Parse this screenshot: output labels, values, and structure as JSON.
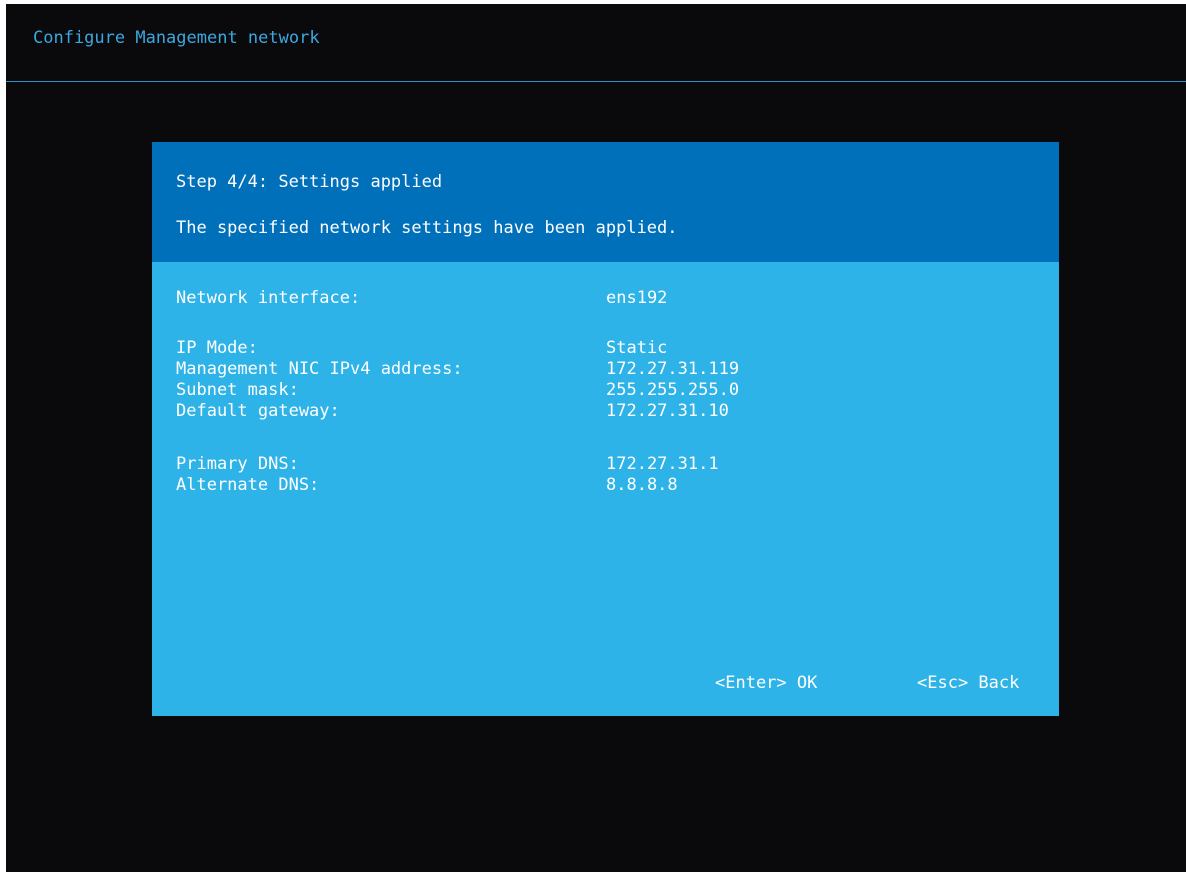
{
  "header": {
    "title": "Configure Management network"
  },
  "dialog": {
    "step_title": "Step 4/4: Settings applied",
    "description": "The specified network settings have been applied.",
    "fields": [
      {
        "label": "Network interface:",
        "value": "ens192"
      },
      {
        "label": "IP Mode:",
        "value": "Static"
      },
      {
        "label": "Management NIC IPv4 address:",
        "value": "172.27.31.119"
      },
      {
        "label": "Subnet mask:",
        "value": "255.255.255.0"
      },
      {
        "label": "Default gateway:",
        "value": "172.27.31.10"
      },
      {
        "label": "Primary DNS:",
        "value": "172.27.31.1"
      },
      {
        "label": "Alternate DNS:",
        "value": "8.8.8.8"
      }
    ],
    "actions": {
      "ok": "<Enter> OK",
      "back": "<Esc> Back"
    }
  },
  "colors": {
    "background": "#0a0a0c",
    "header_text": "#3aa8e0",
    "dialog_head": "#0070bb",
    "dialog_body": "#2eb3e8",
    "text": "#ffffff"
  }
}
